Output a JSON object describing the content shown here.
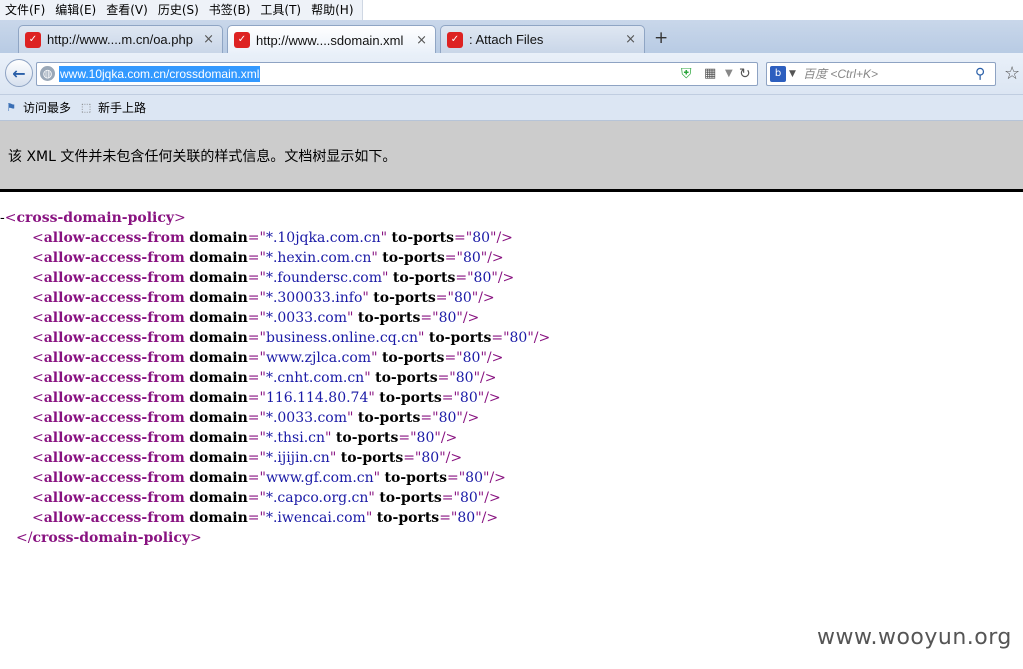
{
  "menu": [
    "文件(F)",
    "编辑(E)",
    "查看(V)",
    "历史(S)",
    "书签(B)",
    "工具(T)",
    "帮助(H)"
  ],
  "tabs": [
    {
      "title": "http://www....m.cn/oa.php",
      "close": "×"
    },
    {
      "title": "http://www....sdomain.xml",
      "close": "×"
    },
    {
      "title": ": Attach Files",
      "close": "×"
    }
  ],
  "new_tab": "+",
  "nav": {
    "url": "www.10jqka.com.cn/crossdomain.xml",
    "search_placeholder": "百度 <Ctrl+K>"
  },
  "bookmarks": [
    "访问最多",
    "新手上路"
  ],
  "info_message": "该 XML 文件并未包含任何关联的样式信息。文档树显示如下。",
  "xml": {
    "root_toggle": "-",
    "root_tag": "cross-domain-policy",
    "child_tag": "allow-access-from",
    "attr_domain": "domain",
    "attr_ports": "to-ports",
    "entries": [
      {
        "domain": "*.10jqka.com.cn",
        "ports": "80"
      },
      {
        "domain": "*.hexin.com.cn",
        "ports": "80"
      },
      {
        "domain": "*.foundersc.com",
        "ports": "80"
      },
      {
        "domain": "*.300033.info",
        "ports": "80"
      },
      {
        "domain": "*.0033.com",
        "ports": "80"
      },
      {
        "domain": "business.online.cq.cn",
        "ports": "80"
      },
      {
        "domain": "www.zjlca.com",
        "ports": "80"
      },
      {
        "domain": "*.cnht.com.cn",
        "ports": "80"
      },
      {
        "domain": "116.114.80.74",
        "ports": "80"
      },
      {
        "domain": "*.0033.com",
        "ports": "80"
      },
      {
        "domain": "*.thsi.cn",
        "ports": "80"
      },
      {
        "domain": "*.ijijin.cn",
        "ports": "80"
      },
      {
        "domain": "www.gf.com.cn",
        "ports": "80"
      },
      {
        "domain": "*.capco.org.cn",
        "ports": "80"
      },
      {
        "domain": "*.iwencai.com",
        "ports": "80"
      }
    ]
  },
  "watermark": "www.wooyun.org",
  "colors": {
    "tag": "#881280",
    "value": "#1a1aa6",
    "url_highlight": "#3399ff",
    "infobar": "#cccccc"
  }
}
